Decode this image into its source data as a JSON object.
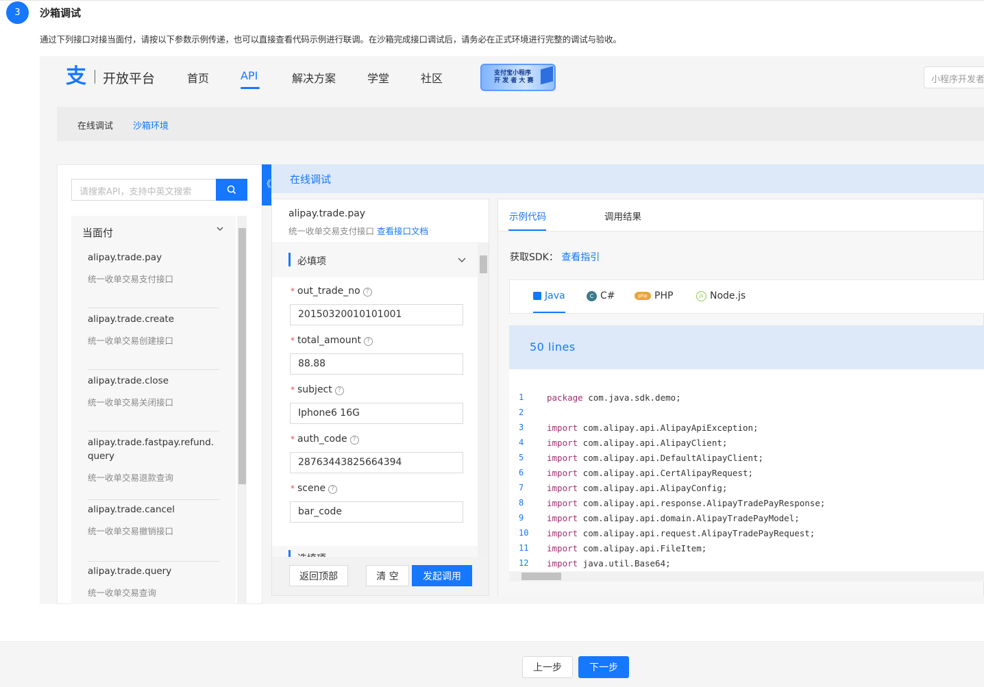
{
  "step": {
    "number": "3",
    "title": "沙箱调试",
    "description": "通过下列接口对接当面付，请按以下参数示例传递，也可以直接查看代码示例进行联调。在沙箱完成接口调试后，请务必在正式环境进行完整的调试与验收。"
  },
  "nav": {
    "brand": "开放平台",
    "items": [
      "首页",
      "API",
      "解决方案",
      "学堂",
      "社区"
    ],
    "active": "API",
    "banner_line1": "支付宝小程序",
    "banner_line2": "开 发 者 大 赛",
    "search_placeholder": "小程序开发者"
  },
  "breadcrumb": {
    "item1": "在线调试",
    "item2": "沙箱环境"
  },
  "sidebar": {
    "search_placeholder": "请搜索API，支持中英文搜索",
    "group": "当面付",
    "apis": [
      {
        "name": "alipay.trade.pay",
        "desc": "统一收单交易支付接口"
      },
      {
        "name": "alipay.trade.create",
        "desc": "统一收单交易创建接口"
      },
      {
        "name": "alipay.trade.close",
        "desc": "统一收单交易关闭接口"
      },
      {
        "name": "alipay.trade.fastpay.refund.query",
        "desc": "统一收单交易退款查询"
      },
      {
        "name": "alipay.trade.cancel",
        "desc": "统一收单交易撤销接口"
      },
      {
        "name": "alipay.trade.query",
        "desc": "统一收单交易查询"
      }
    ]
  },
  "online": {
    "title": "在线调试",
    "collapse_icon": "《",
    "api_name": "alipay.trade.pay",
    "api_desc": "统一收单交易支付接口",
    "doc_link": "查看接口文档",
    "required_title": "必填项",
    "optional_title": "选填项",
    "fields": [
      {
        "label": "out_trade_no",
        "value": "20150320010101001"
      },
      {
        "label": "total_amount",
        "value": "88.88"
      },
      {
        "label": "subject",
        "value": "Iphone6 16G"
      },
      {
        "label": "auth_code",
        "value": "28763443825664394"
      },
      {
        "label": "scene",
        "value": "bar_code"
      }
    ],
    "btn_top": "返回顶部",
    "btn_clear": "清 空",
    "btn_invoke": "发起调用"
  },
  "code": {
    "tab_sample": "示例代码",
    "tab_result": "调用结果",
    "sdk_label": "获取SDK：",
    "sdk_link": "查看指引",
    "languages": [
      "Java",
      "C#",
      "PHP",
      "Node.js"
    ],
    "active_language": "Java",
    "lines_count": "50 lines",
    "lines": [
      {
        "n": "1",
        "kw": "package",
        "rest": " com.java.sdk.demo;"
      },
      {
        "n": "2",
        "kw": "",
        "rest": ""
      },
      {
        "n": "3",
        "kw": "import",
        "rest": " com.alipay.api.AlipayApiException;"
      },
      {
        "n": "4",
        "kw": "import",
        "rest": " com.alipay.api.AlipayClient;"
      },
      {
        "n": "5",
        "kw": "import",
        "rest": " com.alipay.api.DefaultAlipayClient;"
      },
      {
        "n": "6",
        "kw": "import",
        "rest": " com.alipay.api.CertAlipayRequest;"
      },
      {
        "n": "7",
        "kw": "import",
        "rest": " com.alipay.api.AlipayConfig;"
      },
      {
        "n": "8",
        "kw": "import",
        "rest": " com.alipay.api.response.AlipayTradePayResponse;"
      },
      {
        "n": "9",
        "kw": "import",
        "rest": " com.alipay.api.domain.AlipayTradePayModel;"
      },
      {
        "n": "10",
        "kw": "import",
        "rest": " com.alipay.api.request.AlipayTradePayRequest;"
      },
      {
        "n": "11",
        "kw": "import",
        "rest": " com.alipay.api.FileItem;"
      },
      {
        "n": "12",
        "kw": "import",
        "rest": " java.util.Base64;"
      }
    ]
  },
  "footer": {
    "prev": "上一步",
    "next": "下一步"
  },
  "colors": {
    "primary": "#1677ff",
    "required": "#e34d59",
    "keyword": "#a0306e"
  }
}
